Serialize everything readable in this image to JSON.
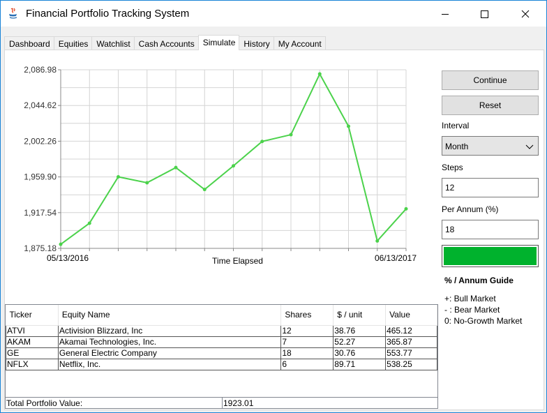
{
  "window": {
    "title": "Financial Portfolio Tracking System",
    "controls": [
      "minimize",
      "maximize",
      "close"
    ]
  },
  "tabs": [
    {
      "label": "Dashboard",
      "active": false
    },
    {
      "label": "Equities",
      "active": false
    },
    {
      "label": "Watchlist",
      "active": false
    },
    {
      "label": "Cash Accounts",
      "active": false
    },
    {
      "label": "Simulate",
      "active": true
    },
    {
      "label": "History",
      "active": false
    },
    {
      "label": "My Account",
      "active": false
    }
  ],
  "chart_data": {
    "type": "line",
    "x_start_label": "05/13/2016",
    "x_end_label": "06/13/2017",
    "xlabel": "Time Elapsed",
    "ylabel": "",
    "y_tick_labels": [
      "2,086.98",
      "2,044.62",
      "2,002.26",
      "1,959.90",
      "1,917.54",
      "1,875.18"
    ],
    "ylim": [
      1875.18,
      2086.98
    ],
    "grid": true,
    "series": [
      {
        "color": "#4bd24b",
        "values": [
          1880,
          1905,
          1960,
          1953,
          1971,
          1945,
          1973,
          2002,
          2010,
          2082,
          2020,
          1884,
          1922
        ]
      }
    ]
  },
  "controls": {
    "continue_label": "Continue",
    "reset_label": "Reset",
    "interval_label": "Interval",
    "interval_value": "Month",
    "steps_label": "Steps",
    "steps_value": "12",
    "per_annum_label": "Per Annum (%)",
    "per_annum_value": "18",
    "guide_color": "#00b22d"
  },
  "guide": {
    "title": "% / Annum Guide",
    "lines": [
      "+: Bull Market",
      "- : Bear Market",
      "0: No-Growth Market"
    ]
  },
  "table": {
    "headers": [
      "Ticker",
      "Equity Name",
      "Shares",
      "$ / unit",
      "Value"
    ],
    "rows": [
      [
        "ATVI",
        "Activision Blizzard, Inc",
        "12",
        "38.76",
        "465.12"
      ],
      [
        "AKAM",
        "Akamai Technologies, Inc.",
        "7",
        "52.27",
        "365.87"
      ],
      [
        "GE",
        "General Electric Company",
        "18",
        "30.76",
        "553.77"
      ],
      [
        "NFLX",
        "Netflix, Inc.",
        "6",
        "89.71",
        "538.25"
      ]
    ],
    "total_label": "Total Portfolio Value:",
    "total_value": "1923.01"
  }
}
